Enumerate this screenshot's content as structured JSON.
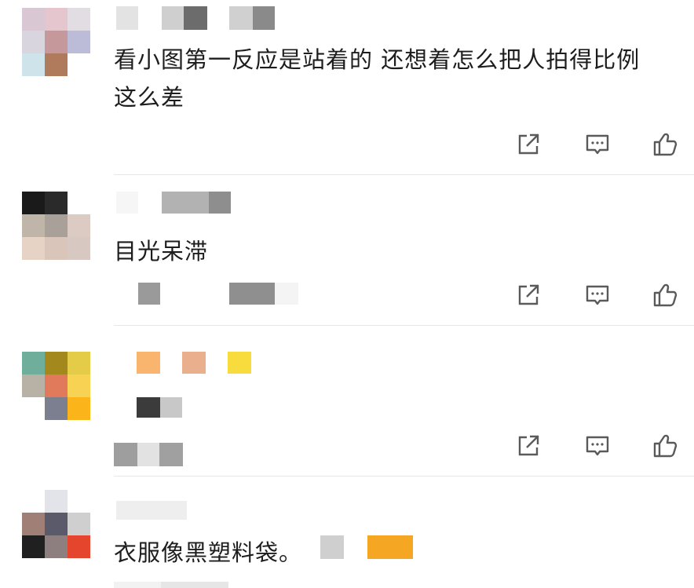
{
  "comments": [
    {
      "text": "看小图第一反应是站着的 还想着怎么把人拍得比例这么差",
      "avatar_colors": [
        "#d9c7d3",
        "#e6c6ce",
        "#e2dce3",
        "#d8d5df",
        "#c5989c",
        "#bcbcd9",
        "#cfe3ea",
        "#b07a5c",
        "#ffffff"
      ],
      "name_colors": [
        "#e6e6e6",
        "#f2f2f2",
        "#c9c9c9",
        "#6d6d6d",
        "#ffffff",
        "#d4d4d4",
        "#8c8c8c"
      ]
    },
    {
      "text": "目光呆滞",
      "avatar_colors": [
        "#1a1a1a",
        "#2a2a2a",
        "#ffffff",
        "#bfb5a8",
        "#a9a09a",
        "#dccbc2",
        "#e6d3c6",
        "#d9c5ba",
        "#d8c8c2"
      ],
      "name_colors": [
        "#f2f2f2",
        "#b0b0b0",
        "#9a9a9a",
        "#8f8f8f"
      ]
    },
    {
      "text": "",
      "avatar_colors": [
        "#6fae9b",
        "#a3881e",
        "#e5cc48",
        "#b7b2a5",
        "#e07a5a",
        "#f7d253",
        "#ffffff",
        "#7c7f90",
        "#fbb51a"
      ],
      "name_colors": [
        "#f9b46e",
        "#eab08d",
        "#f8dc3e"
      ],
      "sub_colors": [
        "#3b3b3b",
        "#c8c8c8"
      ]
    },
    {
      "text": "衣服像黑塑料袋。",
      "avatar_colors": [
        "#ffffff",
        "#e3e3ea",
        "#ffffff",
        "#a07f76",
        "#5a5a6a",
        "#cfcfcf",
        "#202020",
        "#8d7f7f",
        "#e4452c"
      ],
      "name_colors": [
        "#cfcfcf",
        "#f5a623"
      ]
    }
  ],
  "icons": {
    "share": "share-icon",
    "reply": "comment-icon",
    "like": "thumbs-up-icon"
  }
}
